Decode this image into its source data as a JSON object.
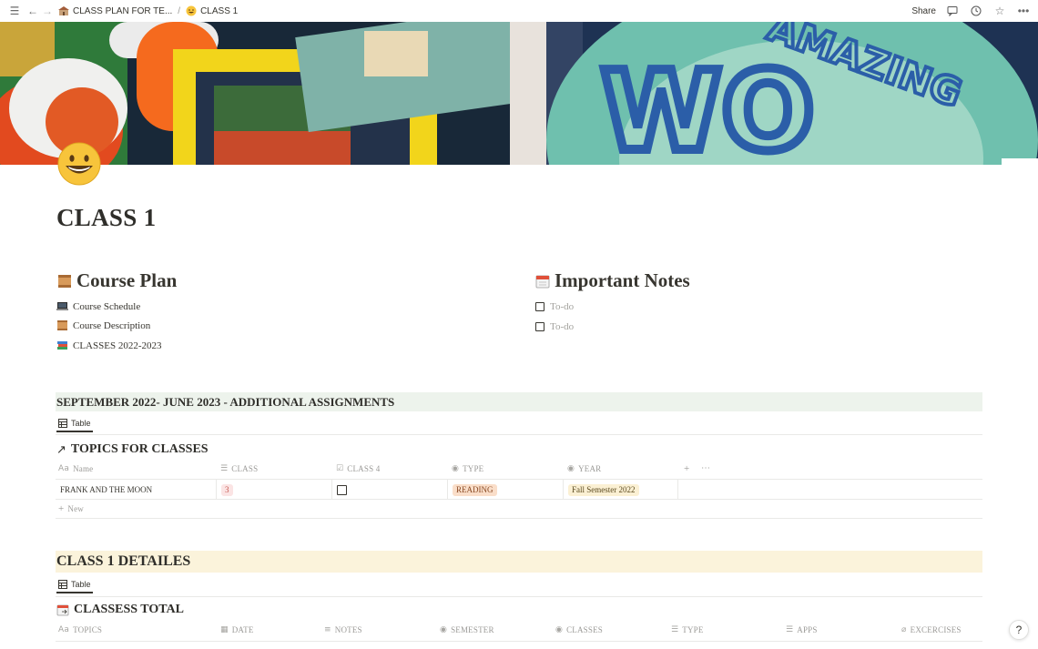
{
  "topbar": {
    "breadcrumbs": [
      {
        "label": "CLASS PLAN FOR TE..."
      },
      {
        "label": "CLASS 1"
      }
    ],
    "share_label": "Share"
  },
  "page": {
    "title": "CLASS 1"
  },
  "course_plan": {
    "heading": "Course Plan",
    "links": [
      {
        "label": "Course Schedule",
        "icon": "laptop-icon"
      },
      {
        "label": "Course Description",
        "icon": "scroll-icon"
      },
      {
        "label": "CLASSES 2022-2023",
        "icon": "books-icon"
      }
    ]
  },
  "important_notes": {
    "heading": "Important Notes",
    "todos": [
      {
        "placeholder": "To-do"
      },
      {
        "placeholder": "To-do"
      }
    ]
  },
  "assignments": {
    "band_title": "SEPTEMBER 2022- JUNE 2023 - ADDITIONAL ASSIGNMENTS",
    "view_tab": "Table",
    "db_title": "TOPICS FOR CLASSES",
    "columns": [
      "Name",
      "CLASS",
      "CLASS 4",
      "TYPE",
      "YEAR"
    ],
    "rows": [
      {
        "name": "FRANK AND THE MOON",
        "class": "3",
        "class4_checked": false,
        "type": "READING",
        "year": "Fall Semester 2022"
      }
    ],
    "new_label": "New"
  },
  "details": {
    "band_title": "CLASS 1 DETAILES",
    "view_tab": "Table",
    "db_title": "CLASSESS TOTAL",
    "columns": [
      "TOPICS",
      "DATE",
      "NOTES",
      "SEMESTER",
      "CLASSES",
      "TYPE",
      "APPS",
      "EXCERCISES"
    ]
  },
  "colors": {
    "green_band": "#edf3ec",
    "yellow_band": "#fbf3db",
    "tag_red": "#fbe4e4",
    "tag_orange": "#fadec9",
    "tag_yellow": "#fbf0d3"
  }
}
